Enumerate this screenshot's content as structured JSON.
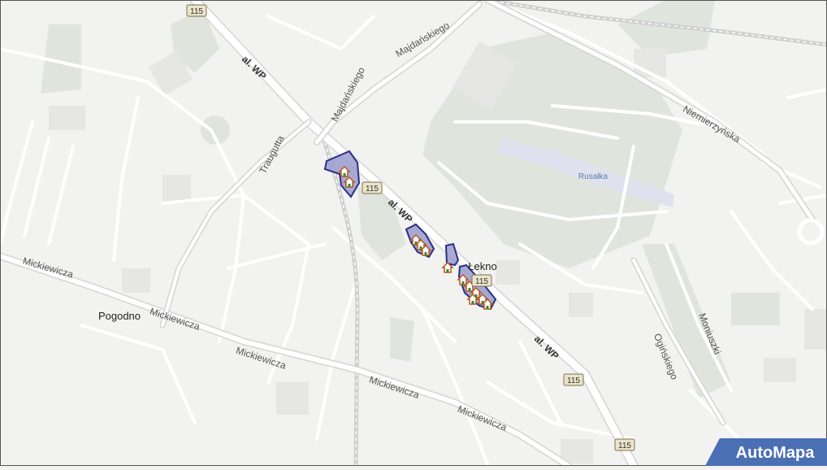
{
  "labels": {
    "av1": "al. WP",
    "av2": "al. WP",
    "av3": "al. WP",
    "majdanskiego1": "Majdańskiego",
    "majdanskiego2": "Majdańskiego",
    "niemierzynska": "Niemierzyńska",
    "traugutta": "Traugutta",
    "mickiewicza1": "Mickiewicza",
    "mickiewicza2": "Mickiewicza",
    "mickiewicza3": "Mickiewicza",
    "mickiewicza4": "Mickiewicza",
    "mickiewicza5": "Mickiewicza",
    "moniuszki": "Moniuszki",
    "oginskiego": "Ogińskiego",
    "rusalka": "Rusałka",
    "pogodno": "Pogodno",
    "lekno": "Łekno"
  },
  "road_shields": [
    "115",
    "115",
    "115",
    "115",
    "115"
  ],
  "brand": {
    "name": "AutoMapa"
  },
  "colors": {
    "background": "#f2f2f1",
    "road": "#ffffff",
    "park": "#dfe5dc",
    "water": "#dfe2ee",
    "highlight_fill": "#9a9ccc",
    "highlight_stroke": "#2b2f86",
    "brand_bg": "#4a6fb3"
  }
}
